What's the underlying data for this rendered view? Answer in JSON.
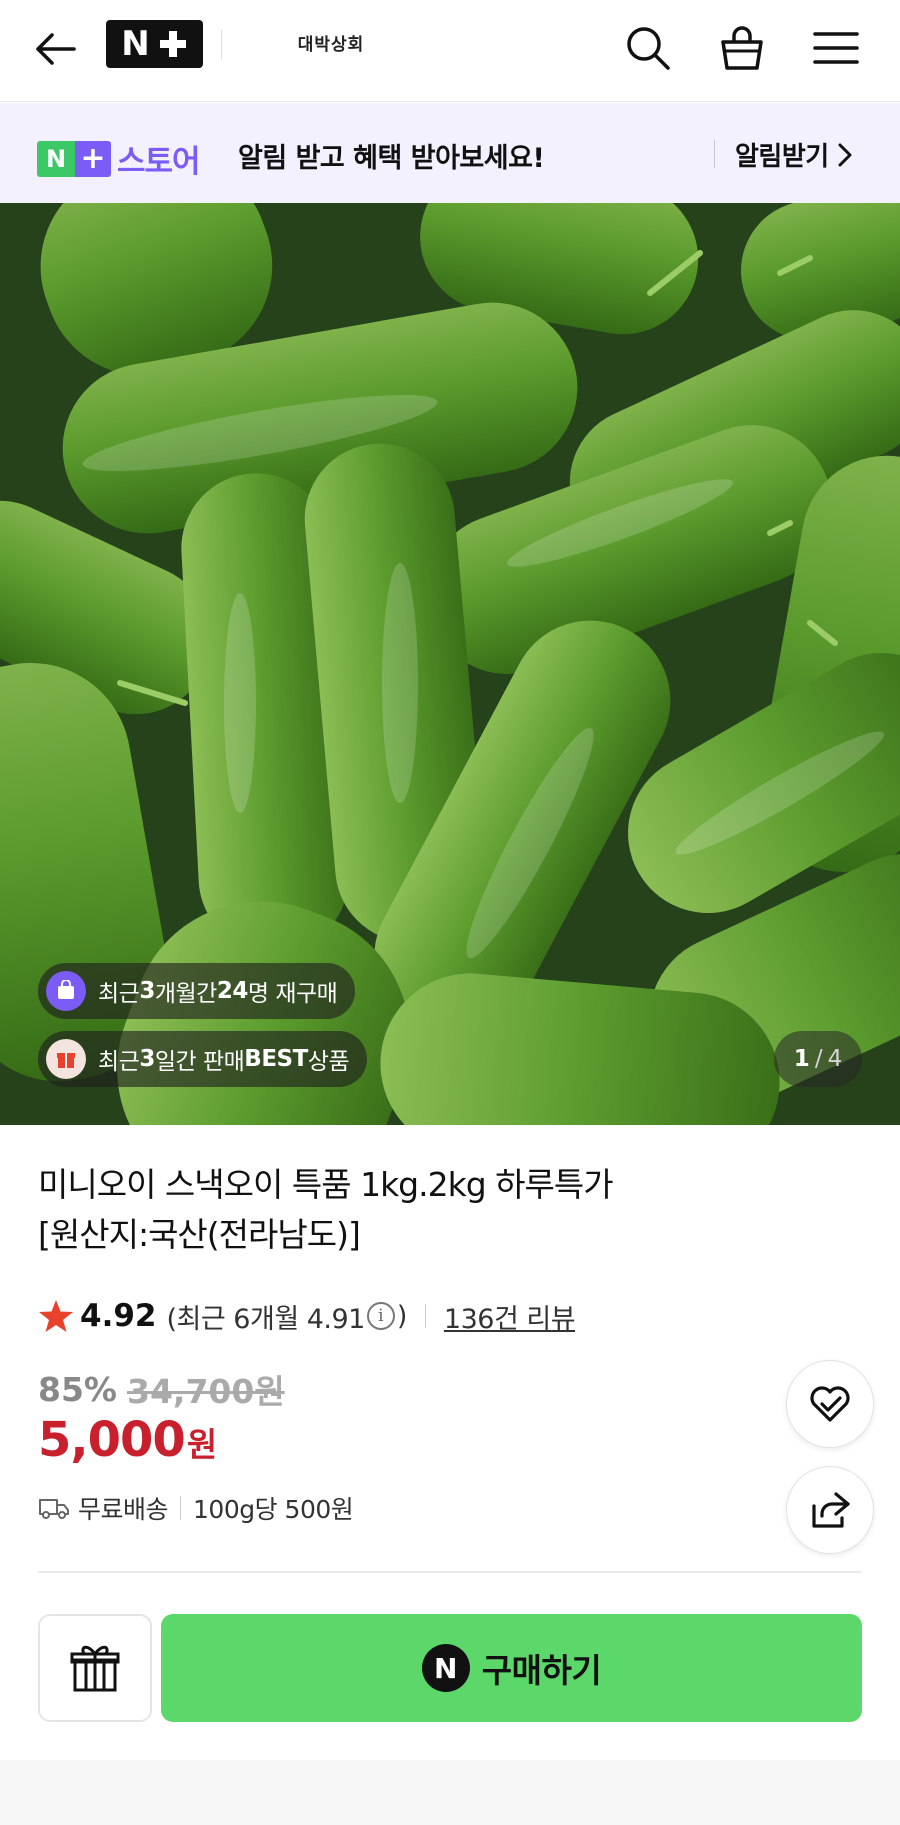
{
  "header": {
    "logo_text": "N",
    "store_name": "대박상회",
    "icons": [
      "back-arrow-icon",
      "search-icon",
      "shopping-bag-icon",
      "menu-icon"
    ]
  },
  "banner": {
    "logo_n": "N",
    "logo_plus": "+",
    "logo_word": "스토어",
    "message": "알림 받고 혜택 받아보세요!",
    "link_label": "알림받기"
  },
  "image_badges": {
    "repurchase": {
      "prefix": "최근 ",
      "b1": "3",
      "mid": "개월간 ",
      "b2": "24",
      "suffix": "명 재구매"
    },
    "best": {
      "prefix": "최근 ",
      "b1": "3",
      "mid": "일간 판매 ",
      "b2": "BEST",
      "suffix": " 상품"
    }
  },
  "pager": {
    "current": "1",
    "separator": "/",
    "total": "4"
  },
  "product": {
    "title_line1": "미니오이 스낵오이 특품 1kg.2kg 하루특가",
    "title_line2": "[원산지:국산(전라남도)]",
    "rating": "4.92",
    "recent_rating_prefix": "(최근 6개월 4.91",
    "recent_rating_suffix": ")",
    "info_glyph": "i",
    "reviews": "136건 리뷰",
    "discount_rate": "85%",
    "original_price": "34,700원",
    "price": "5,000",
    "price_unit": "원",
    "shipping": "무료배송",
    "unit_price": "100g당 500원"
  },
  "actions": {
    "buy_logo": "N",
    "buy_label": "구매하기"
  },
  "colors": {
    "accent_green": "#5cd86a",
    "price_red": "#c8202c",
    "star": "#e8412c",
    "banner_bg": "#f3f1fd",
    "store_purple": "#7b5cf6"
  }
}
